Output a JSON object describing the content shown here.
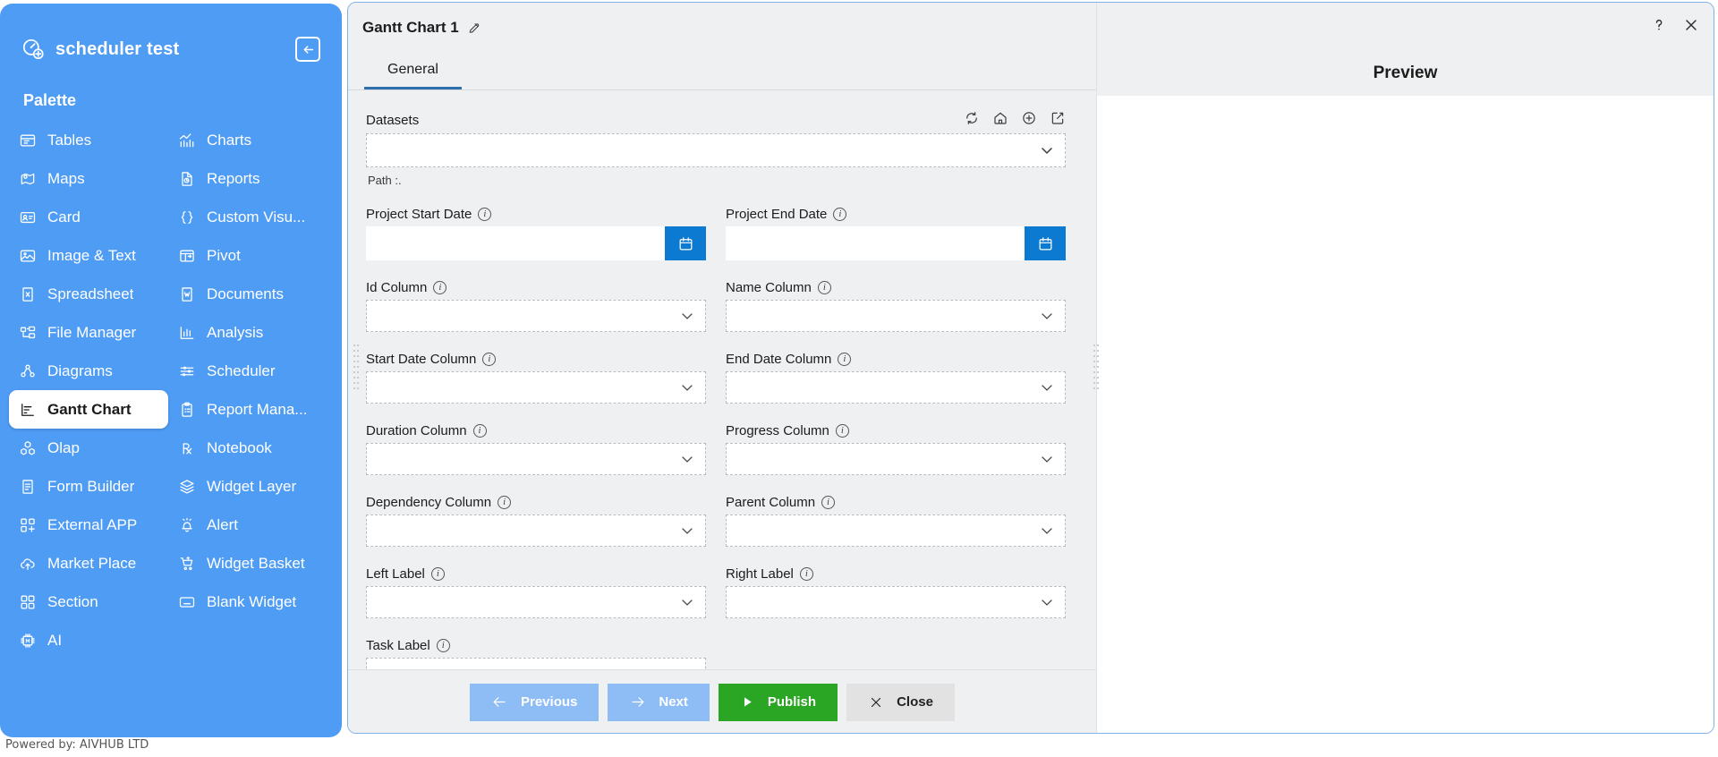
{
  "sidebar": {
    "app_title": "scheduler test",
    "logo_icon": "dashboard-add-icon",
    "collapse_icon": "arrow-left-box-icon",
    "palette_heading": "Palette",
    "items": [
      {
        "label": "Tables",
        "icon": "table-icon",
        "active": false,
        "full": false
      },
      {
        "label": "Charts",
        "icon": "chart-line-icon",
        "active": false,
        "full": false
      },
      {
        "label": "Maps",
        "icon": "map-pin-icon",
        "active": false,
        "full": false
      },
      {
        "label": "Reports",
        "icon": "report-doc-icon",
        "active": false,
        "full": false
      },
      {
        "label": "Card",
        "icon": "id-card-icon",
        "active": false,
        "full": false
      },
      {
        "label": "Custom Visu...",
        "icon": "braces-icon",
        "active": false,
        "full": false
      },
      {
        "label": "Image & Text",
        "icon": "image-icon",
        "active": false,
        "full": false
      },
      {
        "label": "Pivot",
        "icon": "pivot-icon",
        "active": false,
        "full": false
      },
      {
        "label": "Spreadsheet",
        "icon": "excel-file-icon",
        "active": false,
        "full": false
      },
      {
        "label": "Documents",
        "icon": "word-file-icon",
        "active": false,
        "full": false
      },
      {
        "label": "File Manager",
        "icon": "folder-tree-icon",
        "active": false,
        "full": false
      },
      {
        "label": "Analysis",
        "icon": "analysis-bar-icon",
        "active": false,
        "full": false
      },
      {
        "label": "Diagrams",
        "icon": "node-graph-icon",
        "active": false,
        "full": false
      },
      {
        "label": "Scheduler",
        "icon": "sliders-icon",
        "active": false,
        "full": false
      },
      {
        "label": "Gantt Chart",
        "icon": "gantt-icon",
        "active": true,
        "full": false
      },
      {
        "label": "Report Mana...",
        "icon": "clipboard-icon",
        "active": false,
        "full": false
      },
      {
        "label": "Olap",
        "icon": "cubes-icon",
        "active": false,
        "full": false
      },
      {
        "label": "Notebook",
        "icon": "rx-icon",
        "active": false,
        "full": false
      },
      {
        "label": "Form Builder",
        "icon": "form-doc-icon",
        "active": false,
        "full": false
      },
      {
        "label": "Widget Layer",
        "icon": "layers-icon",
        "active": false,
        "full": false
      },
      {
        "label": "External APP",
        "icon": "apps-add-icon",
        "active": false,
        "full": false
      },
      {
        "label": "Alert",
        "icon": "bell-alert-icon",
        "active": false,
        "full": false
      },
      {
        "label": "Market Place",
        "icon": "cloud-upload-icon",
        "active": false,
        "full": false
      },
      {
        "label": "Widget Basket",
        "icon": "cart-icon",
        "active": false,
        "full": false
      },
      {
        "label": "Section",
        "icon": "grid-squares-icon",
        "active": false,
        "full": false
      },
      {
        "label": "Blank Widget",
        "icon": "blank-widget-icon",
        "active": false,
        "full": false
      },
      {
        "label": "AI",
        "icon": "ai-chip-icon",
        "active": false,
        "full": true
      }
    ],
    "powered_by": "Powered by: AIVHUB LTD"
  },
  "dialog": {
    "title": "Gantt Chart 1",
    "title_edit_icon": "pencil-edit-icon",
    "help_icon": "question-mark-icon",
    "close_icon": "close-x-icon",
    "tabs": [
      {
        "label": "General",
        "active": true
      }
    ],
    "datasets": {
      "label": "Datasets",
      "value": "",
      "placeholder": "",
      "path_note": "Path :.",
      "icons": [
        {
          "name": "refresh-icon"
        },
        {
          "name": "home-icon"
        },
        {
          "name": "plus-circle-icon"
        },
        {
          "name": "edit-square-icon"
        }
      ]
    },
    "fields": [
      {
        "label": "Project Start Date",
        "value": "",
        "type": "date",
        "info": true,
        "trailing_icon": "calendar-icon"
      },
      {
        "label": "Project End Date",
        "value": "",
        "type": "date",
        "info": true,
        "trailing_icon": "calendar-icon"
      },
      {
        "label": "Id Column",
        "value": "",
        "type": "select",
        "info": true,
        "trailing_icon": "chevron-down-icon"
      },
      {
        "label": "Name Column",
        "value": "",
        "type": "select",
        "info": true,
        "trailing_icon": "chevron-down-icon"
      },
      {
        "label": "Start Date Column",
        "value": "",
        "type": "select",
        "info": true,
        "trailing_icon": "chevron-down-icon"
      },
      {
        "label": "End Date Column",
        "value": "",
        "type": "select",
        "info": true,
        "trailing_icon": "chevron-down-icon"
      },
      {
        "label": "Duration Column",
        "value": "",
        "type": "select",
        "info": true,
        "trailing_icon": "chevron-down-icon"
      },
      {
        "label": "Progress Column",
        "value": "",
        "type": "select",
        "info": true,
        "trailing_icon": "chevron-down-icon"
      },
      {
        "label": "Dependency Column",
        "value": "",
        "type": "select",
        "info": true,
        "trailing_icon": "chevron-down-icon"
      },
      {
        "label": "Parent Column",
        "value": "",
        "type": "select",
        "info": true,
        "trailing_icon": "chevron-down-icon"
      },
      {
        "label": "Left Label",
        "value": "",
        "type": "select",
        "info": true,
        "trailing_icon": "chevron-down-icon"
      },
      {
        "label": "Right Label",
        "value": "",
        "type": "select",
        "info": true,
        "trailing_icon": "chevron-down-icon"
      },
      {
        "label": "Task Label",
        "value": "",
        "type": "select",
        "info": true,
        "trailing_icon": "chevron-down-icon"
      }
    ],
    "footer_buttons": [
      {
        "label": "Previous",
        "icon": "arrow-left-icon",
        "style": "blue"
      },
      {
        "label": "Next",
        "icon": "arrow-right-icon",
        "style": "blue"
      },
      {
        "label": "Publish",
        "icon": "play-icon",
        "style": "green"
      },
      {
        "label": "Close",
        "icon": "close-x-icon",
        "style": "grey"
      }
    ]
  },
  "preview": {
    "title": "Preview"
  },
  "colors": {
    "sidebar_blue": "#4f9cf5",
    "accent_blue": "#0c7ad1",
    "publish_green": "#2aa524",
    "button_blue": "#8ebdf5",
    "panel_grey": "#eef0f1",
    "tab_underline": "#2f6fb0"
  }
}
